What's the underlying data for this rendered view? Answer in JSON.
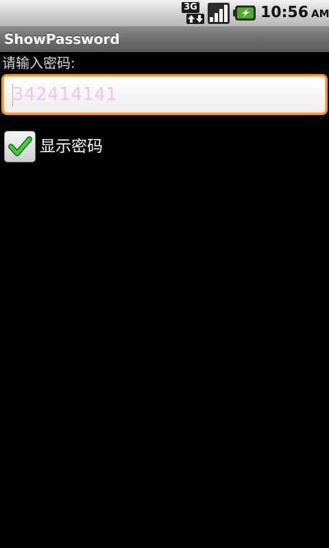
{
  "status_bar": {
    "network_type": "3G",
    "network_icon": "3g-data-icon",
    "signal_icon": "signal-strength-icon",
    "battery_icon": "battery-charging-icon",
    "time": "10:56",
    "ampm": "AM"
  },
  "title_bar": {
    "title": "ShowPassword"
  },
  "form": {
    "prompt_label": "请输入密码:",
    "password_value": "342414141",
    "show_password_label": "显示密码",
    "show_password_checked": true
  },
  "colors": {
    "focus_border": "#f7931e",
    "check_green": "#2fb52f",
    "field_text": "#f2c2ec"
  }
}
